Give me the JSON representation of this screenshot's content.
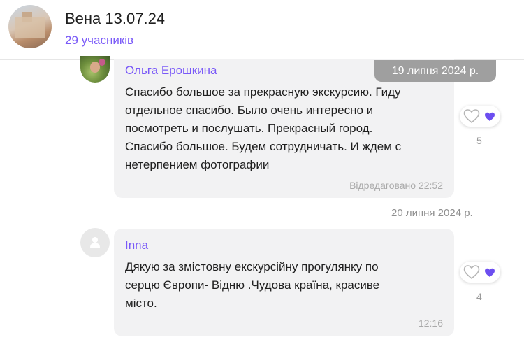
{
  "header": {
    "title": "Вена 13.07.24",
    "members": "29 учасників"
  },
  "dates": {
    "first": "19 липня 2024 р.",
    "second": "20 липня 2024 р."
  },
  "messages": [
    {
      "sender": "Ольга Ерошкина",
      "text": "Спасибо большое за прекрасную экскурсию. Гиду\nотдельное спасибо. Было очень интересно и\nпосмотреть и послушать. Прекрасный город.\nСпасибо большое. Будем сотрудничать. И ждем с\nнетерпением фотографии",
      "meta": "Відредаговано 22:52",
      "reaction_count": "5"
    },
    {
      "sender": "Inna",
      "text": "Дякую за змістовну екскурсійну прогулянку по\nсерцю Європи- Відню .Чудова країна, красиве\nмісто.",
      "meta": "12:16",
      "reaction_count": "4"
    }
  ],
  "colors": {
    "accent": "#7a5af8",
    "bubble": "#f2f2f3",
    "date_pill": "#9f9f9f",
    "heart": "#6c4ef0"
  },
  "icons": {
    "reaction_outline": "heart-outline-icon",
    "reaction_filled": "heart-filled-icon",
    "default_avatar": "user-icon"
  }
}
